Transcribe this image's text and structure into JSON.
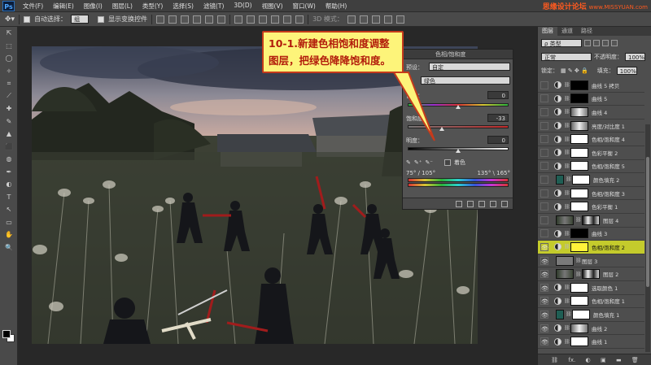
{
  "app": {
    "logo": "Ps"
  },
  "menu": [
    "文件(F)",
    "编辑(E)",
    "图像(I)",
    "图层(L)",
    "类型(Y)",
    "选择(S)",
    "滤镜(T)",
    "3D(D)",
    "视图(V)",
    "窗口(W)",
    "帮助(H)"
  ],
  "watermark": {
    "brand": "思缘设计论坛",
    "url": "www.MISSYUAN.com"
  },
  "options": {
    "auto_select_label": "自动选择：",
    "auto_select_value": "组",
    "show_transform_label": "显示变换控件",
    "mode_3d_label": "3D 模式："
  },
  "tools": [
    "⇱",
    "⬚",
    "◯",
    "✧",
    "⌗",
    "⟋",
    "✚",
    "✎",
    "▲",
    "⬛",
    "◍",
    "✒",
    "◐",
    "T",
    "↖",
    "▭",
    "✋",
    "🔍"
  ],
  "properties": {
    "title": "色相/饱和度",
    "preset_label": "预设：",
    "preset_value": "自定",
    "channel_value": "绿色",
    "hue_label": "色相：",
    "hue_value": "0",
    "saturation_label": "饱和度：",
    "saturation_value": "-33",
    "lightness_label": "明度：",
    "lightness_value": "0",
    "colorize_label": "着色",
    "range_left": "75° / 105°",
    "range_right": "135° \\ 165°",
    "hue_slider_fraction": 0.5,
    "saturation_slider_fraction": 0.34,
    "lightness_slider_fraction": 0.5
  },
  "callout": {
    "line1": "10-1.新建色相饱和度调整",
    "line2": "图层，把绿色降降饱和度。"
  },
  "layers_panel": {
    "tabs": [
      "图层",
      "通道",
      "路径"
    ],
    "kind_label": "ρ 类型",
    "blend_mode": "正常",
    "opacity_label": "不透明度：",
    "opacity_value": "100%",
    "lock_label": "锁定：",
    "fill_label": "填充：",
    "fill_value": "100%",
    "layers": [
      {
        "name": "曲线 5 拷贝",
        "kind": "adj",
        "mask": "black",
        "visible": false
      },
      {
        "name": "曲线 5",
        "kind": "adj",
        "mask": "black",
        "visible": false
      },
      {
        "name": "曲线 4",
        "kind": "adj",
        "mask": "gray",
        "visible": false
      },
      {
        "name": "亮度/对比度 1",
        "kind": "adj",
        "mask": "gray",
        "visible": false
      },
      {
        "name": "色相/饱和度 4",
        "kind": "adj",
        "mask": "white",
        "visible": false
      },
      {
        "name": "色彩平衡 2",
        "kind": "adj",
        "mask": "white",
        "visible": false
      },
      {
        "name": "色相/饱和度 5",
        "kind": "adj",
        "mask": "white",
        "visible": false
      },
      {
        "name": "颜色填充 2",
        "kind": "fill",
        "mask": "white",
        "visible": false
      },
      {
        "name": "色相/饱和度 3",
        "kind": "adj",
        "mask": "white",
        "visible": false
      },
      {
        "name": "色彩平衡 1",
        "kind": "adj",
        "mask": "white",
        "visible": false
      },
      {
        "name": "图层 4",
        "kind": "pixel",
        "mask": "grad",
        "visible": false
      },
      {
        "name": "曲线 3",
        "kind": "adj",
        "mask": "black",
        "visible": false
      },
      {
        "name": "色相/饱和度 2",
        "kind": "adj",
        "mask": "white",
        "visible": true,
        "active": true
      },
      {
        "name": "图层 3",
        "kind": "pixel",
        "mask": "none",
        "visible": true
      },
      {
        "name": "图层 2",
        "kind": "pixel",
        "mask": "grad",
        "visible": true
      },
      {
        "name": "选取颜色 1",
        "kind": "adj",
        "mask": "white",
        "visible": true
      },
      {
        "name": "色相/饱和度 1",
        "kind": "adj",
        "mask": "white",
        "visible": true
      },
      {
        "name": "颜色填充 1",
        "kind": "fill",
        "mask": "white",
        "visible": true
      },
      {
        "name": "曲线 2",
        "kind": "adj",
        "mask": "gray",
        "visible": true
      },
      {
        "name": "曲线 1",
        "kind": "adj",
        "mask": "white",
        "visible": true
      }
    ],
    "footer_icons": [
      "⛓",
      "fx.",
      "◐",
      "▣",
      "▬",
      "🗑"
    ]
  },
  "colors": {
    "callout_bg": "#fdf47a",
    "callout_text": "#b21c0b",
    "active_layer": "#c4cb2c"
  }
}
